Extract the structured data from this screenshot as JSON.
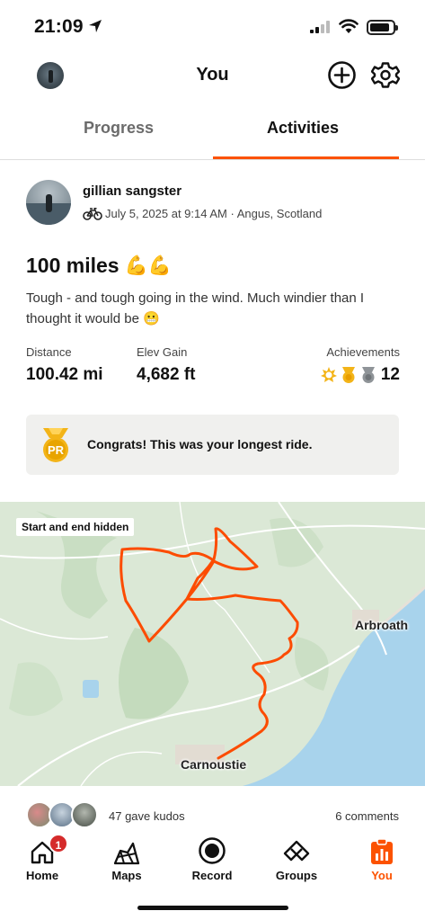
{
  "status_bar": {
    "time": "21:09"
  },
  "header": {
    "title": "You"
  },
  "tabs": [
    {
      "label": "Progress",
      "active": false
    },
    {
      "label": "Activities",
      "active": true
    }
  ],
  "activity": {
    "athlete_name": "gillian sangster",
    "meta": "July 5, 2025 at 9:14 AM · Angus, Scotland",
    "title": "100 miles",
    "title_emoji": "💪💪",
    "description": "Tough - and tough going in the wind. Much windier than I thought it would be 😬",
    "stats": {
      "distance": {
        "label": "Distance",
        "value": "100.42 mi"
      },
      "elevation": {
        "label": "Elev Gain",
        "value": "4,682 ft"
      },
      "achievements": {
        "label": "Achievements",
        "count": "12"
      }
    },
    "pr_banner": {
      "text": "Congrats! This was your longest ride.",
      "badge_text": "PR"
    },
    "map": {
      "label": "Start and end hidden",
      "places": [
        "Arbroath",
        "Carnoustie"
      ]
    },
    "kudos": {
      "text": "47 gave kudos",
      "comments": "6 comments"
    }
  },
  "bottom_nav": [
    {
      "label": "Home",
      "badge": "1"
    },
    {
      "label": "Maps"
    },
    {
      "label": "Record"
    },
    {
      "label": "Groups"
    },
    {
      "label": "You",
      "active": true
    }
  ],
  "colors": {
    "accent": "#fc5200",
    "badge": "#d52b2b",
    "route": "#fc4c02",
    "sea": "#a8d3ec"
  }
}
